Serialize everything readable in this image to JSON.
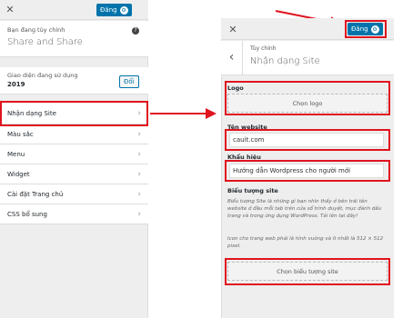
{
  "left_panel": {
    "close_label": "✕",
    "publish_label": "Đăng",
    "customizing_label": "Bạn đang tùy chỉnh",
    "site_title": "Share and Share",
    "help_label": "?",
    "theme_label": "Giao diện đang sử dụng",
    "theme_name": "2019",
    "change_label": "Đổi",
    "menu": [
      {
        "label": "Nhận dạng Site"
      },
      {
        "label": "Màu sắc"
      },
      {
        "label": "Menu"
      },
      {
        "label": "Widget"
      },
      {
        "label": "Cài đặt Trang chủ"
      },
      {
        "label": "CSS bổ sung"
      }
    ],
    "chevron": "›"
  },
  "right_panel": {
    "close_label": "✕",
    "publish_label": "Đăng",
    "back_label": "‹",
    "breadcrumb": "Tùy chỉnh",
    "section_title": "Nhận dạng Site",
    "logo_label": "Logo",
    "select_logo": "Chọn logo",
    "site_title_label": "Tên website",
    "site_title_value": "cauit.com",
    "tagline_label": "Khẩu hiệu",
    "tagline_value": "Hướng dẫn Wordpress cho người mới",
    "site_icon_label": "Biểu tượng site",
    "site_icon_desc1": "Biểu tượng Site là những gì bạn nhìn thấy ở bên trái tên website ở đầu mỗi tab trên cửa sổ trình duyệt, mục đánh dấu trang và trong ứng dụng WordPress. Tải lên tại đây!",
    "site_icon_desc2": "Icon cho trang web phải là hình vuông và ít nhất là 512 × 512 pixel.",
    "select_site_icon": "Chọn biểu tượng site"
  },
  "colors": {
    "accent": "#0073aa",
    "highlight": "#e0141e"
  }
}
